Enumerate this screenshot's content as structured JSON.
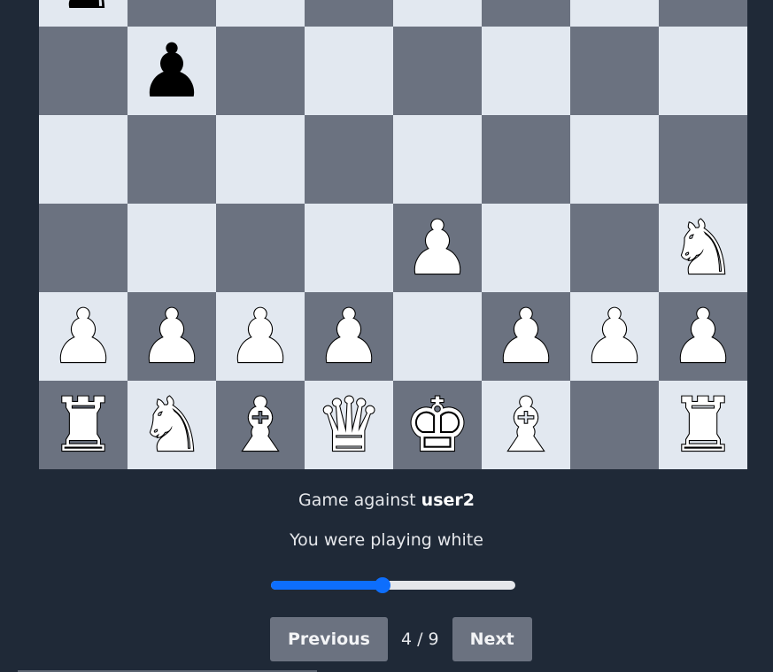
{
  "board": {
    "ranks": [
      [
        {
          "piece": "♞",
          "color": "black"
        },
        {
          "piece": "",
          "color": ""
        },
        {
          "piece": "",
          "color": ""
        },
        {
          "piece": "",
          "color": ""
        },
        {
          "piece": "",
          "color": ""
        },
        {
          "piece": "",
          "color": ""
        },
        {
          "piece": "",
          "color": ""
        },
        {
          "piece": "",
          "color": ""
        }
      ],
      [
        {
          "piece": "",
          "color": ""
        },
        {
          "piece": "♟",
          "color": "black"
        },
        {
          "piece": "",
          "color": ""
        },
        {
          "piece": "",
          "color": ""
        },
        {
          "piece": "",
          "color": ""
        },
        {
          "piece": "",
          "color": ""
        },
        {
          "piece": "",
          "color": ""
        },
        {
          "piece": "",
          "color": ""
        }
      ],
      [
        {
          "piece": "",
          "color": ""
        },
        {
          "piece": "",
          "color": ""
        },
        {
          "piece": "",
          "color": ""
        },
        {
          "piece": "",
          "color": ""
        },
        {
          "piece": "",
          "color": ""
        },
        {
          "piece": "",
          "color": ""
        },
        {
          "piece": "",
          "color": ""
        },
        {
          "piece": "",
          "color": ""
        }
      ],
      [
        {
          "piece": "",
          "color": ""
        },
        {
          "piece": "",
          "color": ""
        },
        {
          "piece": "",
          "color": ""
        },
        {
          "piece": "",
          "color": ""
        },
        {
          "piece": "♟",
          "color": "white"
        },
        {
          "piece": "",
          "color": ""
        },
        {
          "piece": "",
          "color": ""
        },
        {
          "piece": "♞",
          "color": "white"
        }
      ],
      [
        {
          "piece": "♟",
          "color": "white"
        },
        {
          "piece": "♟",
          "color": "white"
        },
        {
          "piece": "♟",
          "color": "white"
        },
        {
          "piece": "♟",
          "color": "white"
        },
        {
          "piece": "",
          "color": ""
        },
        {
          "piece": "♟",
          "color": "white"
        },
        {
          "piece": "♟",
          "color": "white"
        },
        {
          "piece": "♟",
          "color": "white"
        }
      ],
      [
        {
          "piece": "♜",
          "color": "white"
        },
        {
          "piece": "♞",
          "color": "white"
        },
        {
          "piece": "♝",
          "color": "white"
        },
        {
          "piece": "♛",
          "color": "white"
        },
        {
          "piece": "♚",
          "color": "white"
        },
        {
          "piece": "♝",
          "color": "white"
        },
        {
          "piece": "",
          "color": ""
        },
        {
          "piece": "♜",
          "color": "white"
        }
      ]
    ],
    "light_color": "#e2e8f0",
    "dark_color": "#6b7280"
  },
  "game": {
    "against_prefix": "Game against",
    "opponent": "user2",
    "playing_text": "You were playing white"
  },
  "replay": {
    "progress_fraction": 0.456,
    "previous_label": "Previous",
    "counter": "4 / 9",
    "next_label": "Next"
  },
  "colors": {
    "background": "#1f2937",
    "accent": "#0d6efd"
  }
}
